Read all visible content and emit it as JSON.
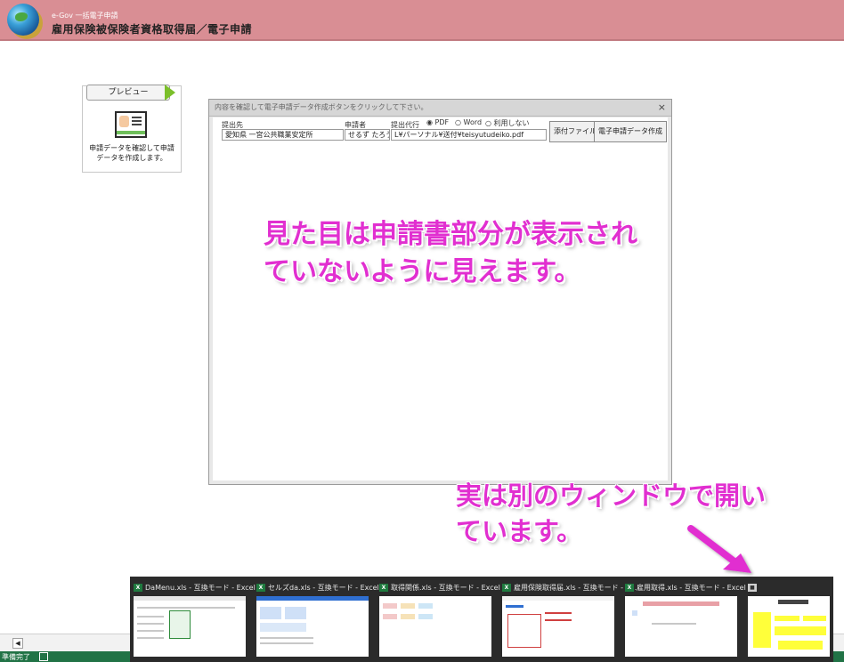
{
  "header": {
    "subtitle": "e-Gov 一括電子申請",
    "title": "雇用保険被保険者資格取得届／電子申請"
  },
  "preview_card": {
    "tab_label": "プレビュー",
    "description": "申請データを確認して申請データを作成します。"
  },
  "dialog": {
    "title": "内容を確認して電子申請データ作成ボタンをクリックして下さい。",
    "close_glyph": "×",
    "field_submit_to_label": "提出先",
    "field_submit_to_value": "愛知県 一宮公共職業安定所",
    "field_applicant_label": "申請者",
    "field_applicant_value": "せるず たろう",
    "field_proxy_label": "提出代行",
    "field_proxy_value": "L¥パーソナル¥送付¥teisyutudeiko.pdf",
    "radio_options": [
      "PDF",
      "Word",
      "利用しない"
    ],
    "radio_selected": "PDF",
    "attach_button": "添付ファイル",
    "create_button": "電子申請データ作成"
  },
  "annotations": {
    "note1": "見た目は申請書部分が表示されていないように見えます。",
    "note2": "実は別のウィンドウで開いています。"
  },
  "status": {
    "text": "準備完了"
  },
  "taskbar": {
    "thumbnails": [
      {
        "title": "DaMenu.xls - 互換モード - Excel"
      },
      {
        "title": "セルズda.xls - 互換モード - Excel"
      },
      {
        "title": "取得関係.xls - 互換モード - Excel"
      },
      {
        "title": "雇用保険取得届.xls - 互換モード - E..."
      },
      {
        "title": "雇用取得.xls - 互換モード - Excel"
      },
      {
        "title": ""
      }
    ]
  },
  "colors": {
    "header_bg": "#d98e94",
    "annotation": "#e12fd0",
    "status_bar": "#217346",
    "taskbar_bg": "#2b2b2b"
  },
  "icons": [
    "globe-icon",
    "preview-arrow-icon",
    "applicant-card-icon",
    "excel-icon",
    "pointer-arrow-icon"
  ]
}
